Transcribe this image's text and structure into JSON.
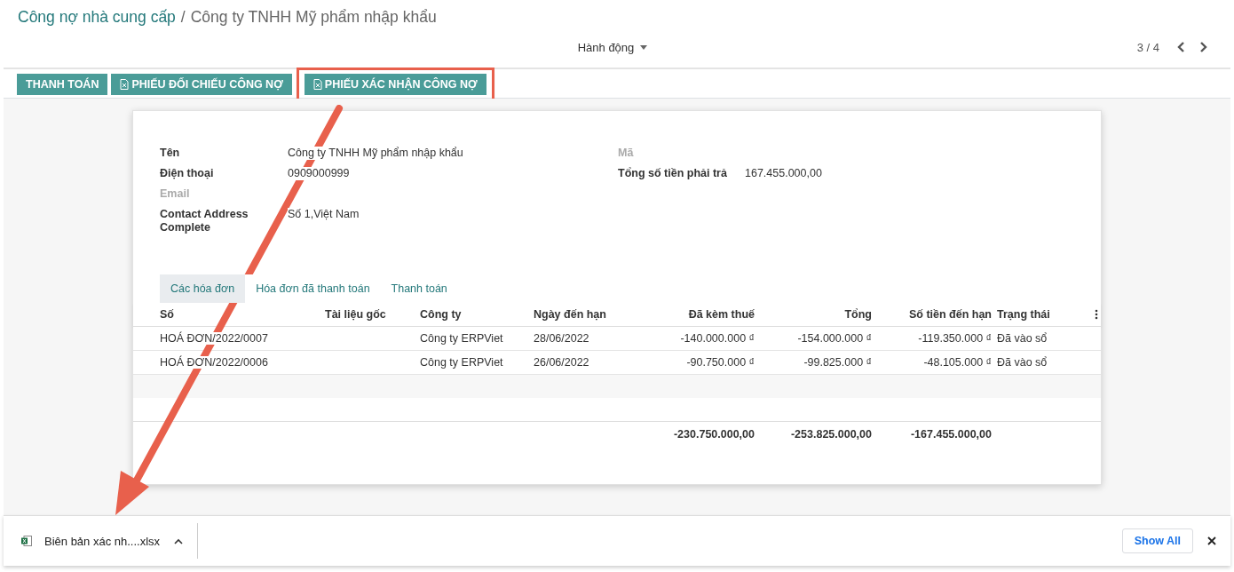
{
  "breadcrumb": {
    "parent": "Công nợ nhà cung cấp",
    "separator": "/",
    "current": "Công ty TNHH Mỹ phẩm nhập khẩu"
  },
  "actions_menu": "Hành động",
  "pager": "3 / 4",
  "buttons": [
    {
      "label": "THANH TOÁN",
      "kind": "plain",
      "highlighted": false
    },
    {
      "label": "PHIẾU ĐỐI CHIẾU CÔNG NỢ",
      "kind": "excel",
      "highlighted": false
    },
    {
      "label": "PHIẾU XÁC NHẬN CÔNG NỢ",
      "kind": "excel",
      "highlighted": true
    }
  ],
  "fields_left": [
    {
      "label": "Tên",
      "value": "Công ty TNHH Mỹ phẩm nhập khẩu",
      "muted": false
    },
    {
      "label": "Điện thoại",
      "value": "0909000999",
      "muted": false
    },
    {
      "label": "Email",
      "muted": true
    },
    {
      "label": "Contact Address Complete",
      "value": "Số 1,Việt Nam",
      "muted": false
    }
  ],
  "fields_right": [
    {
      "label": "Mã",
      "muted": true
    },
    {
      "label": "Tổng số tiền phải trả",
      "value": "167.455.000,00",
      "muted": false
    }
  ],
  "tabs": [
    {
      "label": "Các hóa đơn",
      "selected": true
    },
    {
      "label": "Hóa đơn đã thanh toán",
      "selected": false
    },
    {
      "label": "Thanh toán",
      "selected": false
    }
  ],
  "table": {
    "columns": [
      {
        "label": "Số",
        "kind": "text"
      },
      {
        "label": "Tài liệu gốc",
        "kind": "text"
      },
      {
        "label": "Công ty",
        "kind": "text"
      },
      {
        "label": "Ngày đến hạn",
        "kind": "text"
      },
      {
        "label": "Đã kèm thuế",
        "kind": "number",
        "total": "-230.750.000,00"
      },
      {
        "label": "Tổng",
        "kind": "number",
        "total": "-253.825.000,00"
      },
      {
        "label": "Số tiền đến hạn",
        "kind": "number",
        "total": "-167.455.000,00"
      },
      {
        "label": "Trạng thái",
        "kind": "text"
      }
    ],
    "rows": [
      [
        "HOÁ ĐƠN/2022/0007",
        "",
        "Công ty ERPViet",
        "28/06/2022",
        "-140.000.000 ₫",
        "-154.000.000 ₫",
        "-119.350.000 ₫",
        "Đã vào sổ"
      ],
      [
        "HOÁ ĐƠN/2022/0006",
        "",
        "Công ty ERPViet",
        "26/06/2022",
        "-90.750.000 ₫",
        "-99.825.000 ₫",
        "-48.105.000 ₫",
        "Đã vào sổ"
      ]
    ]
  },
  "download_bar": {
    "file": "Biên bản xác nh....xlsx",
    "show_all": "Show All"
  }
}
